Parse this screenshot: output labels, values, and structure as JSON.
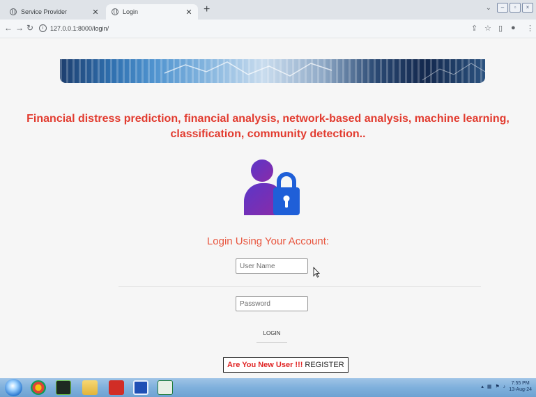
{
  "browser": {
    "tabs": [
      {
        "title": "Service Provider",
        "active": false
      },
      {
        "title": "Login",
        "active": true
      }
    ],
    "new_tab": "+",
    "url": "127.0.0.1:8000/login/"
  },
  "page": {
    "headline": "Financial distress prediction, financial analysis, network-based analysis, machine learning, classification, community detection..",
    "login_title": "Login Using Your Account:",
    "username_placeholder": "User Name",
    "password_placeholder": "Password",
    "login_button": "LOGIN",
    "register_question": "Are You New User !!!",
    "register_link": "REGISTER"
  },
  "taskbar": {
    "time": "7:55 PM",
    "date": "13-Aug-24"
  },
  "colors": {
    "headline": "#e23b2f",
    "login_title": "#e8553e",
    "icon_purple": "#7a2fb0",
    "icon_blue": "#1f5fd8"
  }
}
